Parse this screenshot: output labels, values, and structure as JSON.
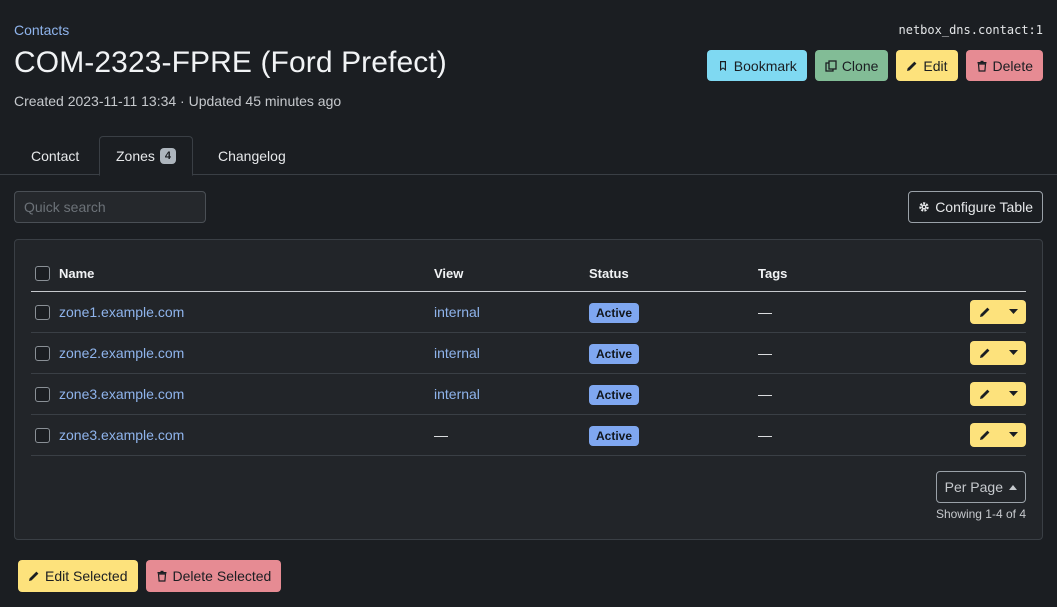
{
  "breadcrumb": "Contacts",
  "object_id": "netbox_dns.contact:1",
  "title": "COM-2323-FPRE (Ford Prefect)",
  "subtitle": "Created 2023-11-11 13:34 · Updated 45 minutes ago",
  "actions": {
    "bookmark": "Bookmark",
    "clone": "Clone",
    "edit": "Edit",
    "delete": "Delete"
  },
  "tabs": [
    {
      "label": "Contact"
    },
    {
      "label": "Zones",
      "count": "4"
    },
    {
      "label": "Changelog"
    }
  ],
  "search": {
    "placeholder": "Quick search"
  },
  "configure_label": "Configure Table",
  "table": {
    "headers": [
      "Name",
      "View",
      "Status",
      "Tags"
    ],
    "rows": [
      {
        "name": "zone1.example.com",
        "view": "internal",
        "status": "Active",
        "tags": "—"
      },
      {
        "name": "zone2.example.com",
        "view": "internal",
        "status": "Active",
        "tags": "—"
      },
      {
        "name": "zone3.example.com",
        "view": "internal",
        "status": "Active",
        "tags": "—"
      },
      {
        "name": "zone3.example.com",
        "view": "—",
        "status": "Active",
        "tags": "—"
      }
    ]
  },
  "pagination": {
    "per_page_label": "Per Page",
    "showing": "Showing 1-4 of 4"
  },
  "bulk": {
    "edit": "Edit Selected",
    "delete": "Delete Selected"
  },
  "colors": {
    "background": "#1b1e22",
    "link": "#8fb4ec",
    "edit": "#fde27c",
    "delete": "#e68b93",
    "bookmark": "#7fd9f2",
    "clone": "#82bc96",
    "status_active": "#7fa7f0"
  },
  "icons": [
    "bookmark-icon",
    "clone-icon",
    "pencil-icon",
    "trash-icon",
    "gear-icon",
    "caret-down-icon",
    "caret-up-icon"
  ]
}
